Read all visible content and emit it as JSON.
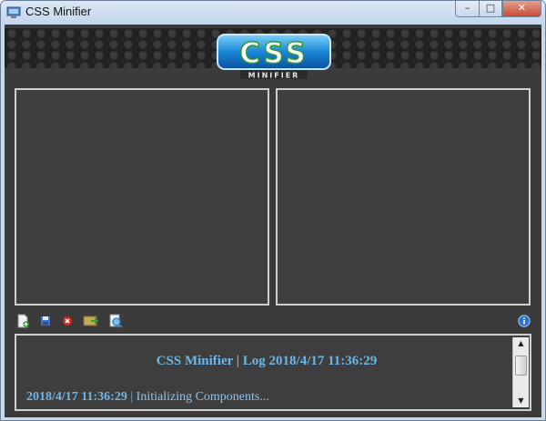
{
  "window": {
    "title": "CSS Minifier",
    "controls": {
      "minimize": "–",
      "maximize": "□",
      "close": "✕"
    }
  },
  "logo": {
    "main_text": "CSS",
    "sub_text": "MINIFIER"
  },
  "toolbar": {
    "icons": [
      "new-file-icon",
      "save-icon",
      "delete-icon",
      "export-icon",
      "preview-icon"
    ],
    "info_icon": "info-icon"
  },
  "log": {
    "header": "CSS Minifier | Log 2018/4/17 11:36:29",
    "entries": [
      {
        "timestamp": "2018/4/17 11:36:29",
        "separator": " | ",
        "message": "Initializing Components..."
      }
    ]
  },
  "colors": {
    "log_text": "#6cb6ea",
    "panel_bg": "#3b3b3b",
    "pane_border": "#cfcfcf"
  }
}
